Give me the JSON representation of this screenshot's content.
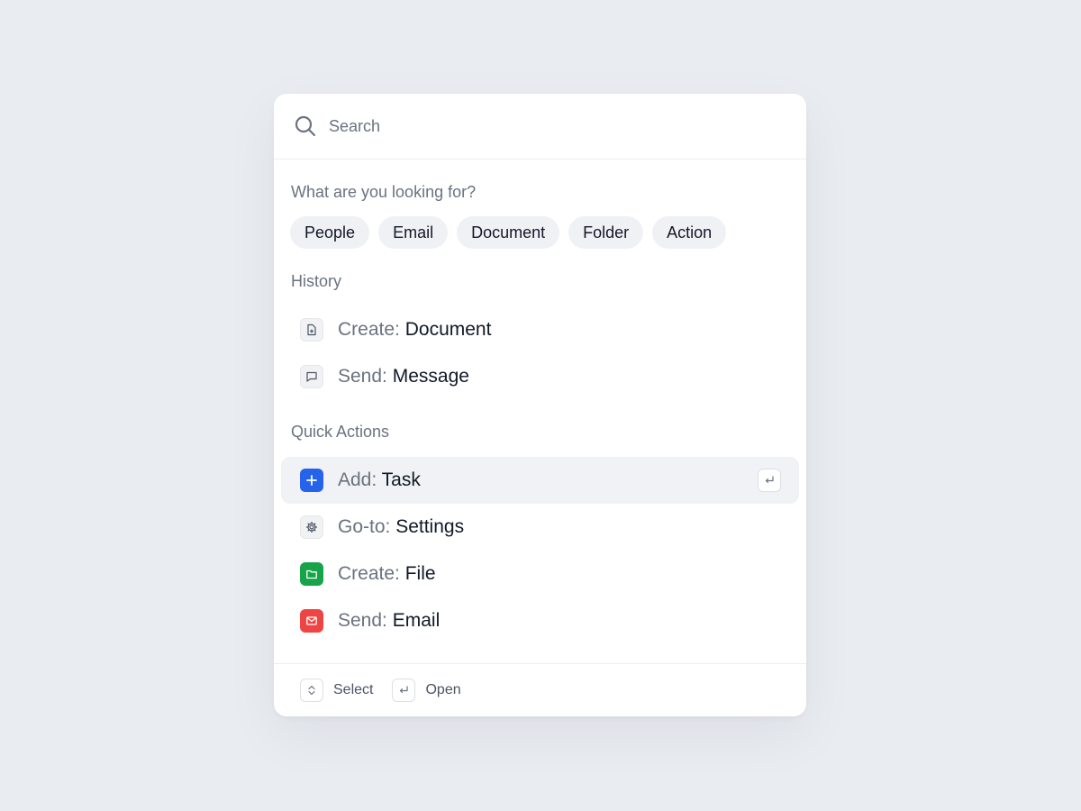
{
  "search": {
    "placeholder": "Search"
  },
  "filters": {
    "label": "What are you looking for?",
    "chips": [
      "People",
      "Email",
      "Document",
      "Folder",
      "Action"
    ]
  },
  "history": {
    "label": "History",
    "items": [
      {
        "verb": "Create:",
        "object": "Document",
        "icon": "file-plus-icon"
      },
      {
        "verb": "Send:",
        "object": "Message",
        "icon": "message-icon"
      }
    ]
  },
  "quick_actions": {
    "label": "Quick Actions",
    "items": [
      {
        "verb": "Add:",
        "object": "Task",
        "icon": "plus-icon",
        "color": "#2563eb"
      },
      {
        "verb": "Go-to:",
        "object": "Settings",
        "icon": "gear-icon",
        "color": "#f1f2f4"
      },
      {
        "verb": "Create:",
        "object": "File",
        "icon": "folder-icon",
        "color": "#16a34a"
      },
      {
        "verb": "Send:",
        "object": "Email",
        "icon": "mail-icon",
        "color": "#ef4444"
      }
    ]
  },
  "footer": {
    "select_label": "Select",
    "open_label": "Open"
  },
  "colors": {
    "background": "#e9ecf1",
    "active_row": "#f1f2f5",
    "muted_text": "#6b7280"
  }
}
